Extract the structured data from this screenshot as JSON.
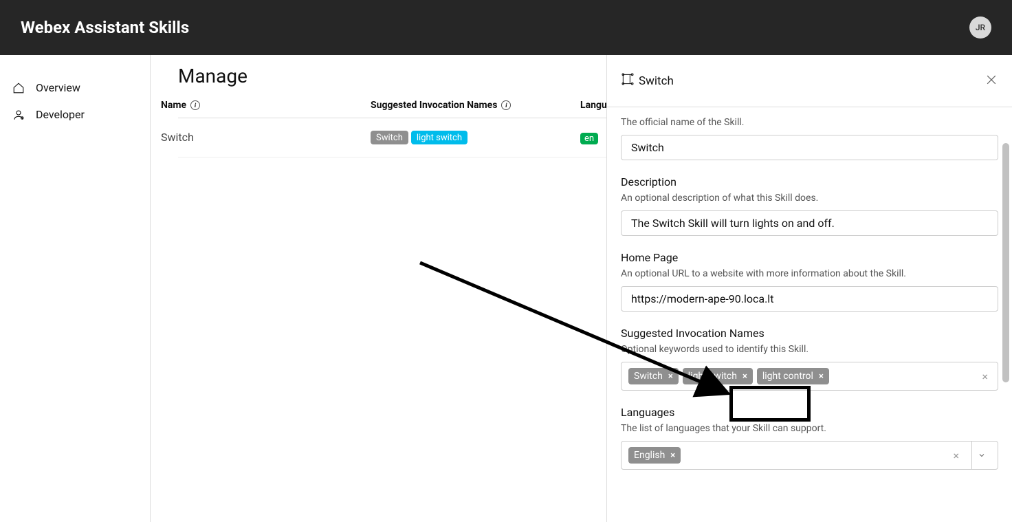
{
  "header": {
    "title": "Webex Assistant Skills",
    "user_initials": "JR"
  },
  "sidebar": {
    "items": [
      {
        "label": "Overview",
        "icon": "home"
      },
      {
        "label": "Developer",
        "icon": "user"
      }
    ]
  },
  "main": {
    "title": "Manage",
    "columns": {
      "name": "Name",
      "invocations": "Suggested Invocation Names",
      "languages": "Langu"
    },
    "rows": [
      {
        "name": "Switch",
        "invocations": [
          {
            "label": "Switch",
            "style": "gray"
          },
          {
            "label": "light switch",
            "style": "cyan"
          }
        ],
        "lang_badge": "en"
      }
    ]
  },
  "drawer": {
    "title": "Switch",
    "fields": {
      "name": {
        "help": "The official name of the Skill.",
        "value": "Switch"
      },
      "description": {
        "label": "Description",
        "help": "An optional description of what this Skill does.",
        "value": "The Switch Skill will turn lights on and off."
      },
      "homepage": {
        "label": "Home Page",
        "help": "An optional URL to a website with more information about the Skill.",
        "value": "https://modern-ape-90.loca.lt"
      },
      "invocations": {
        "label": "Suggested Invocation Names",
        "help": "Optional keywords used to identify this Skill.",
        "tags": [
          "Switch",
          "light switch",
          "light control"
        ]
      },
      "languages": {
        "label": "Languages",
        "help": "The list of languages that your Skill can support.",
        "tags": [
          "English"
        ]
      }
    }
  }
}
